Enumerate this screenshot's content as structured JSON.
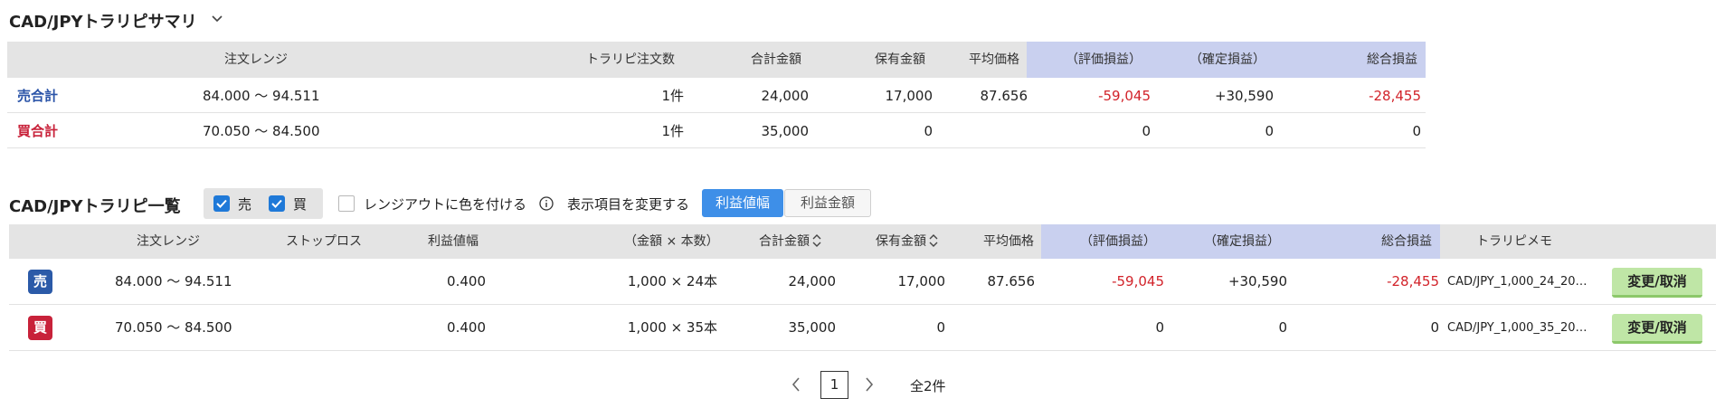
{
  "summary": {
    "title": "CAD/JPYトラリピサマリ",
    "headers": {
      "range": "注文レンジ",
      "orders": "トラリピ注文数",
      "total": "合計金額",
      "held": "保有金額",
      "avg": "平均価格",
      "unrealized": "（評価損益）",
      "realized": "（確定損益）",
      "net": "総合損益"
    },
    "rows": [
      {
        "label": "売合計",
        "range": "84.000 〜 94.511",
        "orders": "1件",
        "total": "24,000",
        "held": "17,000",
        "avg": "87.656",
        "unrealized": "-59,045",
        "realized": "+30,590",
        "net": "-28,455"
      },
      {
        "label": "買合計",
        "range": "70.050 〜 84.500",
        "orders": "1件",
        "total": "35,000",
        "held": "0",
        "avg": "",
        "unrealized": "0",
        "realized": "0",
        "net": "0"
      }
    ]
  },
  "list": {
    "title": "CAD/JPYトラリピ一覧",
    "filters": {
      "sell_label": "売",
      "buy_label": "買",
      "rangeout_label": "レンジアウトに色を付ける"
    },
    "display_label": "表示項目を変更する",
    "toggle": {
      "active": "利益値幅",
      "inactive": "利益金額"
    },
    "headers": {
      "range": "注文レンジ",
      "stoploss": "ストップロス",
      "profit_width": "利益値幅",
      "amount_units": "（金額 × 本数）",
      "total": "合計金額",
      "held": "保有金額",
      "avg": "平均価格",
      "unrealized": "（評価損益）",
      "realized": "（確定損益）",
      "net": "総合損益",
      "memo": "トラリピメモ"
    },
    "rows": [
      {
        "badge": "売",
        "range": "84.000 〜 94.511",
        "stoploss": "",
        "profit_width": "0.400",
        "amount_units": "1,000 × 24本",
        "total": "24,000",
        "held": "17,000",
        "avg": "87.656",
        "unrealized": "-59,045",
        "realized": "+30,590",
        "net": "-28,455",
        "memo": "CAD/JPY_1,000_24_20…",
        "action": "変更/取消"
      },
      {
        "badge": "買",
        "range": "70.050 〜 84.500",
        "stoploss": "",
        "profit_width": "0.400",
        "amount_units": "1,000 × 35本",
        "total": "35,000",
        "held": "0",
        "avg": "",
        "unrealized": "0",
        "realized": "0",
        "net": "0",
        "memo": "CAD/JPY_1,000_35_20…",
        "action": "変更/取消"
      }
    ]
  },
  "pagination": {
    "current": "1",
    "total": "全2件"
  },
  "colors": {
    "accent_blue": "#3e8fe8",
    "sell_blue": "#2b5aa8",
    "buy_red": "#c8223a",
    "loss_red": "#d2232a",
    "action_green": "#bfe6a6",
    "highlight_header": "#c9d0ef"
  },
  "icons": {
    "dropdown": "chevron-down-icon",
    "checkbox_checked": "check-icon",
    "info": "info-icon",
    "sort": "sort-icon",
    "prev": "chevron-left-icon",
    "next": "chevron-right-icon"
  }
}
